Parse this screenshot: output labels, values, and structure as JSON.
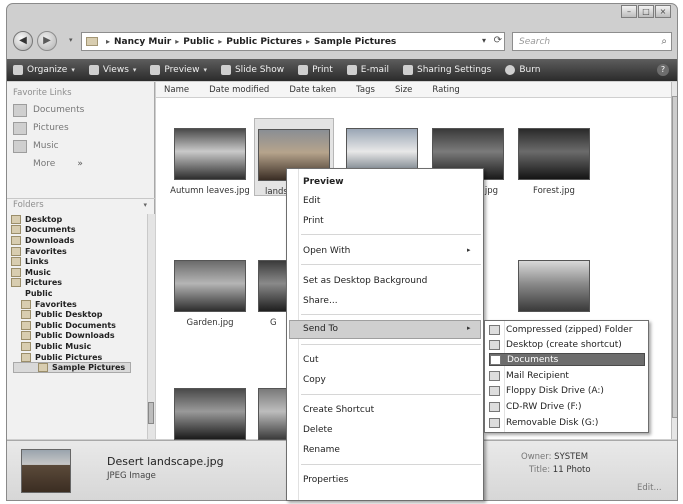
{
  "window": {
    "caption_buttons": [
      "–",
      "□",
      "×"
    ]
  },
  "address": {
    "back_glyph": "◀",
    "forward_glyph": "▶",
    "breadcrumbs": [
      "Nancy Muir",
      "Public",
      "Public Pictures",
      "Sample Pictures"
    ],
    "separator": "▸",
    "search_placeholder": "Search"
  },
  "toolbar": {
    "items": [
      "Organize",
      "Views",
      "Preview",
      "Slide Show",
      "Print",
      "E-mail",
      "Sharing Settings",
      "Burn"
    ],
    "help": "?"
  },
  "navpane": {
    "favorite_links_title": "Favorite Links",
    "favorites": [
      "Documents",
      "Pictures",
      "Music"
    ],
    "more": "More",
    "more_chevron": "»",
    "folders_title": "Folders",
    "tree": [
      "Desktop",
      "Documents",
      "Downloads",
      "Favorites",
      "Links",
      "Music",
      "Pictures",
      "Public",
      "Favorites",
      "Public Desktop",
      "Public Documents",
      "Public Downloads",
      "Public Music",
      "Public Pictures",
      "Sample Pictures"
    ]
  },
  "columns": [
    "Name",
    "Date modified",
    "Date taken",
    "Tags",
    "Size",
    "Rating"
  ],
  "files": [
    {
      "name": "Autumn leaves.jpg",
      "colors": [
        "#4a4a4a",
        "#c9c9c9",
        "#2e2e2e"
      ]
    },
    {
      "name": "landscape.jpg",
      "colors": [
        "#8a8e94",
        "#b6a48c",
        "#3a2d24"
      ]
    },
    {
      "name": "",
      "colors": [
        "#9aa6b5",
        "#e8e8e8",
        "#4d5a66"
      ]
    },
    {
      "name": ".jpg",
      "colors": [
        "#3a3a3a",
        "#7b7b7b",
        "#1a1a1a"
      ]
    },
    {
      "name": "Forest.jpg",
      "colors": [
        "#2a2a2a",
        "#6b6b6b",
        "#141414"
      ]
    },
    {
      "name": "Garden.jpg",
      "colors": [
        "#6b6b6b",
        "#b5b5b5",
        "#2e2e2e"
      ]
    },
    {
      "name": "G",
      "colors": [
        "#3b3b3b",
        "#8a8a8a",
        "#1f1f1f"
      ]
    },
    {
      "name": "",
      "colors": [
        "#d9d9d9",
        "#8b8b8b",
        "#3a3a3a"
      ]
    },
    {
      "name": "",
      "colors": [
        "#4a4a4a",
        "#9a9a9a",
        "#1b1b1b"
      ]
    },
    {
      "name": "",
      "colors": [
        "#7a7a7a",
        "#bdbdbd",
        "#3c3c3c"
      ]
    }
  ],
  "context_menu": {
    "items": [
      "Preview",
      "Edit",
      "Print",
      "Open With",
      "Set as Desktop Background",
      "Share...",
      "Send To",
      "Cut",
      "Copy",
      "Create Shortcut",
      "Delete",
      "Rename",
      "Properties"
    ],
    "arrow": "▸"
  },
  "send_to": {
    "items": [
      "Compressed (zipped) Folder",
      "Desktop (create shortcut)",
      "Documents",
      "Mail Recipient",
      "Floppy Disk Drive (A:)",
      "CD-RW Drive (F:)",
      "Removable Disk (G:)"
    ]
  },
  "details": {
    "file_name": "Desert landscape.jpg",
    "file_type": "JPEG Image",
    "owner_label": "Owner:",
    "owner_value": "SYSTEM",
    "title_label": "Title:",
    "title_value": "11 Photo",
    "edit": "Edit..."
  }
}
